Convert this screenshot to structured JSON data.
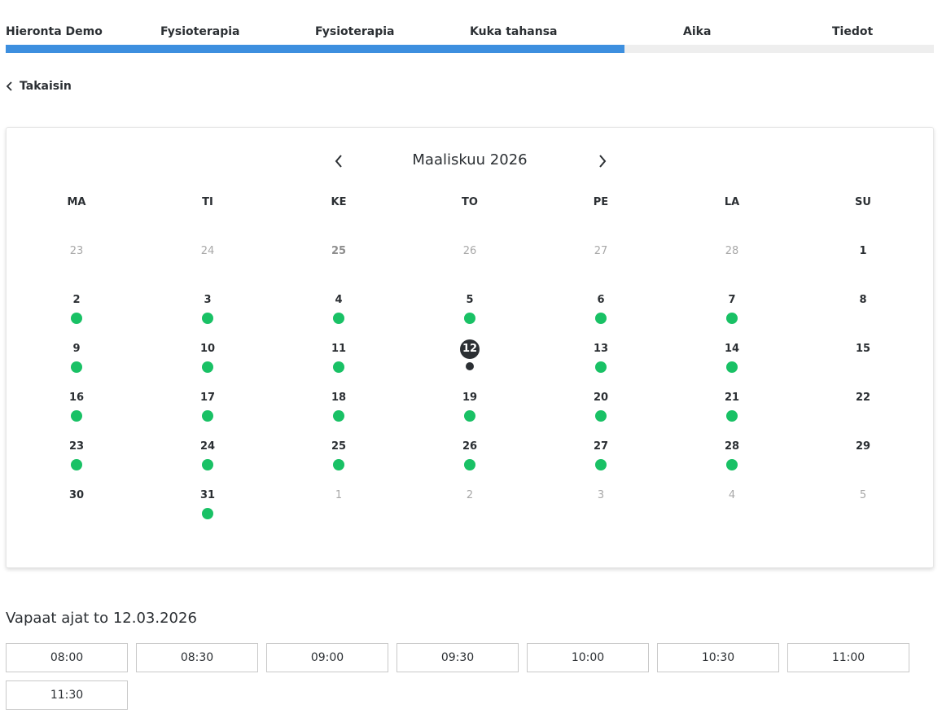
{
  "steps": {
    "items": [
      "Hieronta Demo",
      "Fysioterapia",
      "Fysioterapia",
      "Kuka tahansa",
      "Aika",
      "Tiedot"
    ],
    "progress": 0.667
  },
  "back_label": "Takaisin",
  "calendar": {
    "title": "Maaliskuu 2026",
    "weekdays": [
      "MA",
      "TI",
      "KE",
      "TO",
      "PE",
      "LA",
      "SU"
    ],
    "weeks": [
      [
        {
          "d": "23",
          "other": true
        },
        {
          "d": "24",
          "other": true
        },
        {
          "d": "25",
          "other": true,
          "bold": true
        },
        {
          "d": "26",
          "other": true
        },
        {
          "d": "27",
          "other": true
        },
        {
          "d": "28",
          "other": true
        },
        {
          "d": "1"
        }
      ],
      [
        {
          "d": "2",
          "avail": true
        },
        {
          "d": "3",
          "avail": true
        },
        {
          "d": "4",
          "avail": true
        },
        {
          "d": "5",
          "avail": true
        },
        {
          "d": "6",
          "avail": true
        },
        {
          "d": "7",
          "avail": true
        },
        {
          "d": "8"
        }
      ],
      [
        {
          "d": "9",
          "avail": true
        },
        {
          "d": "10",
          "avail": true
        },
        {
          "d": "11",
          "avail": true
        },
        {
          "d": "12",
          "avail": true,
          "selected": true
        },
        {
          "d": "13",
          "avail": true
        },
        {
          "d": "14",
          "avail": true
        },
        {
          "d": "15"
        }
      ],
      [
        {
          "d": "16",
          "avail": true
        },
        {
          "d": "17",
          "avail": true
        },
        {
          "d": "18",
          "avail": true
        },
        {
          "d": "19",
          "avail": true
        },
        {
          "d": "20",
          "avail": true
        },
        {
          "d": "21",
          "avail": true
        },
        {
          "d": "22"
        }
      ],
      [
        {
          "d": "23",
          "avail": true
        },
        {
          "d": "24",
          "avail": true
        },
        {
          "d": "25",
          "avail": true
        },
        {
          "d": "26",
          "avail": true
        },
        {
          "d": "27",
          "avail": true
        },
        {
          "d": "28",
          "avail": true
        },
        {
          "d": "29"
        }
      ],
      [
        {
          "d": "30"
        },
        {
          "d": "31",
          "avail": true
        },
        {
          "d": "1",
          "other": true
        },
        {
          "d": "2",
          "other": true
        },
        {
          "d": "3",
          "other": true
        },
        {
          "d": "4",
          "other": true
        },
        {
          "d": "5",
          "other": true
        }
      ]
    ]
  },
  "times": {
    "title": "Vapaat ajat to 12.03.2026",
    "slots": [
      "08:00",
      "08:30",
      "09:00",
      "09:30",
      "10:00",
      "10:30",
      "11:00",
      "11:30"
    ]
  },
  "colors": {
    "progress": "#3d8fdf",
    "available": "#19c165",
    "selected": "#2b2f33"
  }
}
